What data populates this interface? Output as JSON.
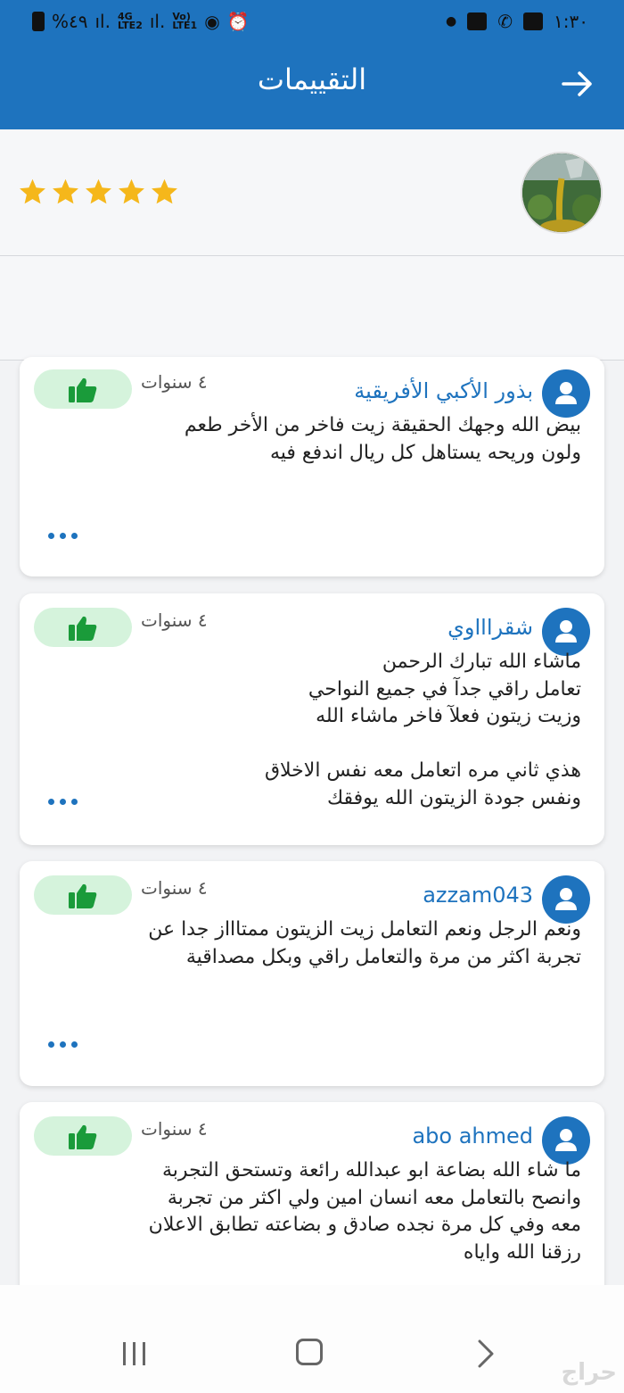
{
  "status_bar": {
    "battery_text": "%٤٩",
    "net1_top": "4G",
    "net1_bottom": "LTE2",
    "net2_top": "Vo)",
    "net2_bottom": "LTE1",
    "time": "١:٣٠"
  },
  "app_bar": {
    "title": "التقييمات",
    "back_icon": "arrow-right-icon"
  },
  "profile": {
    "rating_stars": 5,
    "star_color": "#f5b71b"
  },
  "reviews": [
    {
      "name": "بذور الأكبي الأفريقية",
      "age": "٤ سنوات",
      "text": "بيض الله وجهك  الحقيقة زيت فاخر من الأخر طعم\nولون وريحه يستاهل كل ريال اندفع فيه"
    },
    {
      "name": "شقراااوي",
      "age": "٤ سنوات",
      "text": "ماشاء الله تبارك الرحمن\nتعامل راقي جدآ في جميع النواحي\nوزيت زيتون فعلآ فاخر ماشاء الله\n\nهذي ثاني مره اتعامل معه نفس الاخلاق\nونفس جودة الزيتون الله يوفقك"
    },
    {
      "name": "azzam043",
      "age": "٤ سنوات",
      "text": "ونعم الرجل ونعم التعامل  زيت الزيتون ممتاااز جدا عن\nتجربة اكثر من مرة والتعامل راقي وبكل مصداقية"
    },
    {
      "name": "abo ahmed",
      "age": "٤ سنوات",
      "text": "ما شاء الله بضاعة ابو عبدالله رائعة وتستحق التجربة\nوانصح بالتعامل معه انسان امين ولي اكثر من تجربة\nمعه وفي كل مرة نجده صادق و بضاعته تطابق الاعلان\nرزقنا الله واياه"
    }
  ],
  "colors": {
    "brand": "#1e73be",
    "like_bg": "#d5f3dc",
    "like_icon": "#1a9b3a"
  },
  "watermark": "حراج"
}
